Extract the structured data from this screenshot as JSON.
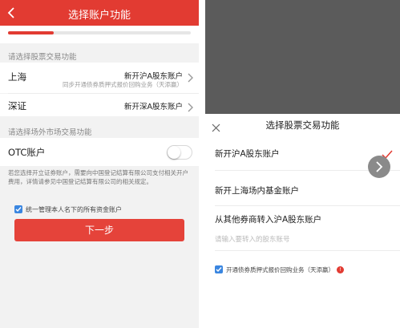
{
  "left": {
    "header": {
      "title": "选择账户功能",
      "bg_color": "#e23b32"
    },
    "progress": {
      "fraction": 0.25
    },
    "stock_section": {
      "label": "请选择股票交易功能",
      "rows": [
        {
          "name": "上海",
          "value": "新开沪A股东账户",
          "sub": "同步开通债券质押式报价回购业务（天添赢）"
        },
        {
          "name": "深证",
          "value": "新开深A股东账户"
        }
      ]
    },
    "otc_section": {
      "label": "请选择场外市场交易功能",
      "row": {
        "name": "OTC账户",
        "toggle_on": false
      }
    },
    "note": "若您选择开立证券账户，需要向中国登记结算有限公司支付相关开户费用，详情请参见中国登记结算有限公司的相关规定。",
    "checkbox": {
      "label": "统一管理本人名下的所有资金账户",
      "checked": true
    },
    "next_button": "下一步"
  },
  "right": {
    "sheet_title": "选择股票交易功能",
    "options": [
      {
        "label": "新开沪A股东账户",
        "selected": true
      },
      {
        "label": "新开上海场内基金账户",
        "selected": false
      },
      {
        "label": "从其他券商转入沪A股东账户",
        "selected": false
      }
    ],
    "input_placeholder": "请输入要转入的股东账号",
    "checkbox": {
      "label": "开通债券质押式报价回购业务（天添赢）",
      "checked": true,
      "info_icon": "!"
    }
  },
  "colors": {
    "accent": "#e23b32",
    "checkbox": "#3a86e0",
    "overlay": "#5b5b5b"
  },
  "icons": [
    "back-arrow-icon",
    "chevron-right-icon",
    "toggle-switch",
    "checkbox-checked-icon",
    "close-icon",
    "checkmark-icon",
    "arrow-right-icon",
    "info-icon"
  ]
}
